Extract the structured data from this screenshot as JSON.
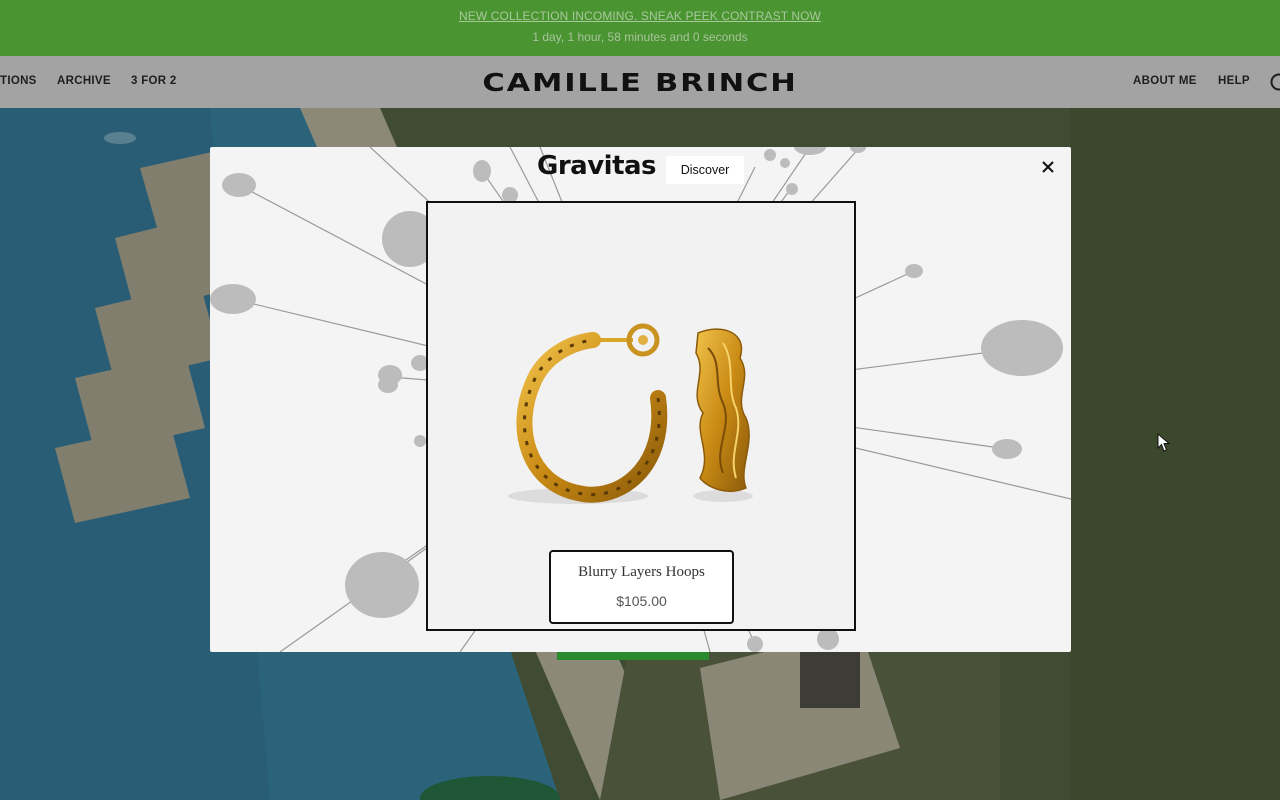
{
  "announcement": {
    "link_text": "NEW COLLECTION INCOMING. SNEAK PEEK CONTRAST NOW",
    "countdown": "1 day, 1 hour, 58 minutes and 0 seconds"
  },
  "header": {
    "brand": "CAMILLE BRINCH",
    "left_nav": [
      "TIONS",
      "ARCHIVE",
      "3 FOR 2"
    ],
    "right_nav": [
      "ABOUT ME",
      "HELP"
    ],
    "icons": {
      "search": "search-icon"
    }
  },
  "popup": {
    "title": "Gravitas",
    "discover_label": "Discover",
    "close_icon": "close-icon",
    "product": {
      "name": "Blurry Layers Hoops",
      "price": "$105.00"
    }
  },
  "colors": {
    "announcement_bg": "#4a9432",
    "header_bg": "#a3a3a3",
    "popup_bg": "#f4f4f4",
    "accent_green": "#2a8a2e"
  }
}
